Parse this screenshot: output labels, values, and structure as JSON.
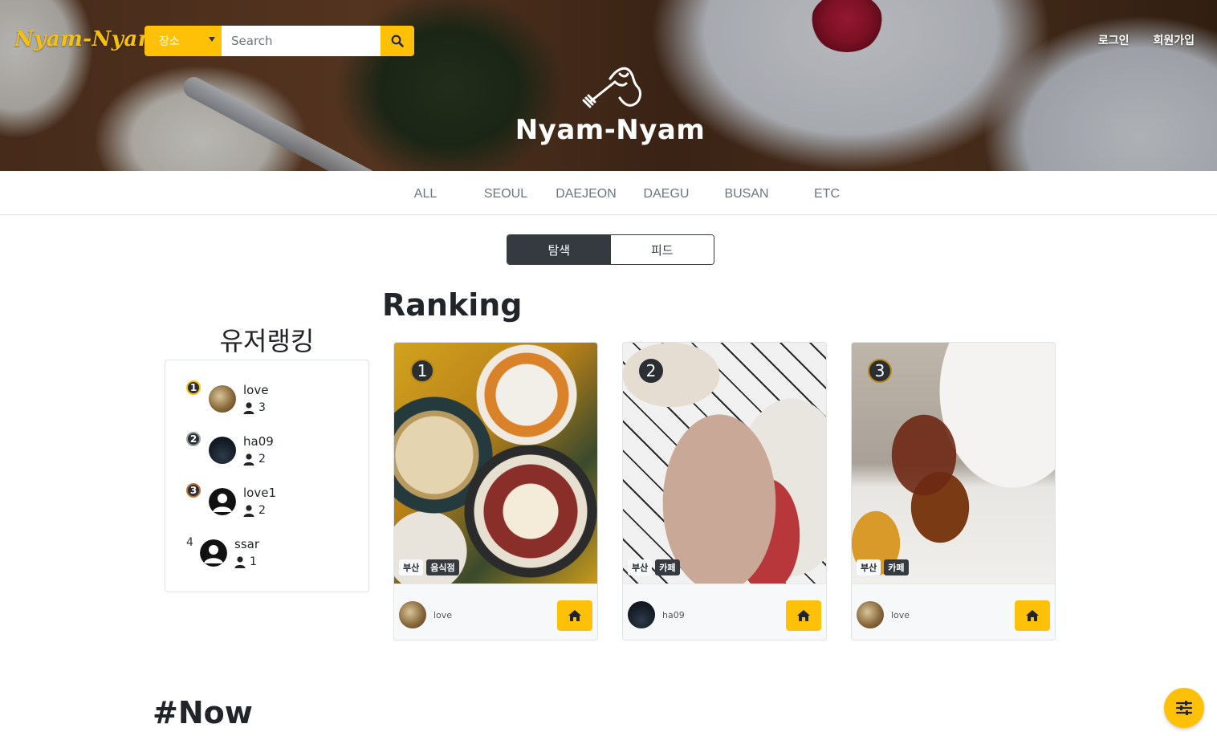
{
  "header": {
    "logo": "Nyam-Nyam",
    "search": {
      "category_selected": "장소",
      "placeholder": "Search"
    },
    "links": {
      "login": "로그인",
      "signup": "회원가입"
    },
    "hero_brand": "Nyam-Nyam"
  },
  "regions": [
    "ALL",
    "SEOUL",
    "DAEJEON",
    "DAEGU",
    "BUSAN",
    "ETC"
  ],
  "view_toggle": {
    "explore": "탐색",
    "feed": "피드",
    "active": "탐색"
  },
  "user_ranking": {
    "title": "유저랭킹",
    "users": [
      {
        "rank": "1",
        "name": "love",
        "followers": "3",
        "avatar": "food-avatar"
      },
      {
        "rank": "2",
        "name": "ha09",
        "followers": "2",
        "avatar": "night-avatar"
      },
      {
        "rank": "3",
        "name": "love1",
        "followers": "2",
        "avatar": "default-avatar"
      },
      {
        "rank": "4",
        "name": "ssar",
        "followers": "1",
        "avatar": "default-avatar"
      }
    ],
    "badge_colors": [
      "#f5c010",
      "#9aa0a6",
      "#b87333"
    ]
  },
  "ranking": {
    "title": "Ranking",
    "cards": [
      {
        "rank": "1",
        "tags": [
          "부산",
          "음식점"
        ],
        "user": "love"
      },
      {
        "rank": "2",
        "tags": [
          "부산",
          "카페"
        ],
        "user": "ha09"
      },
      {
        "rank": "3",
        "tags": [
          "부산",
          "카페"
        ],
        "user": "love"
      }
    ]
  },
  "now": {
    "title": "#Now"
  },
  "colors": {
    "accent": "#ffc107",
    "dark": "#343a40"
  },
  "icons": [
    "search-icon",
    "fork-hand-icon",
    "person-icon",
    "home-icon",
    "sliders-icon"
  ]
}
